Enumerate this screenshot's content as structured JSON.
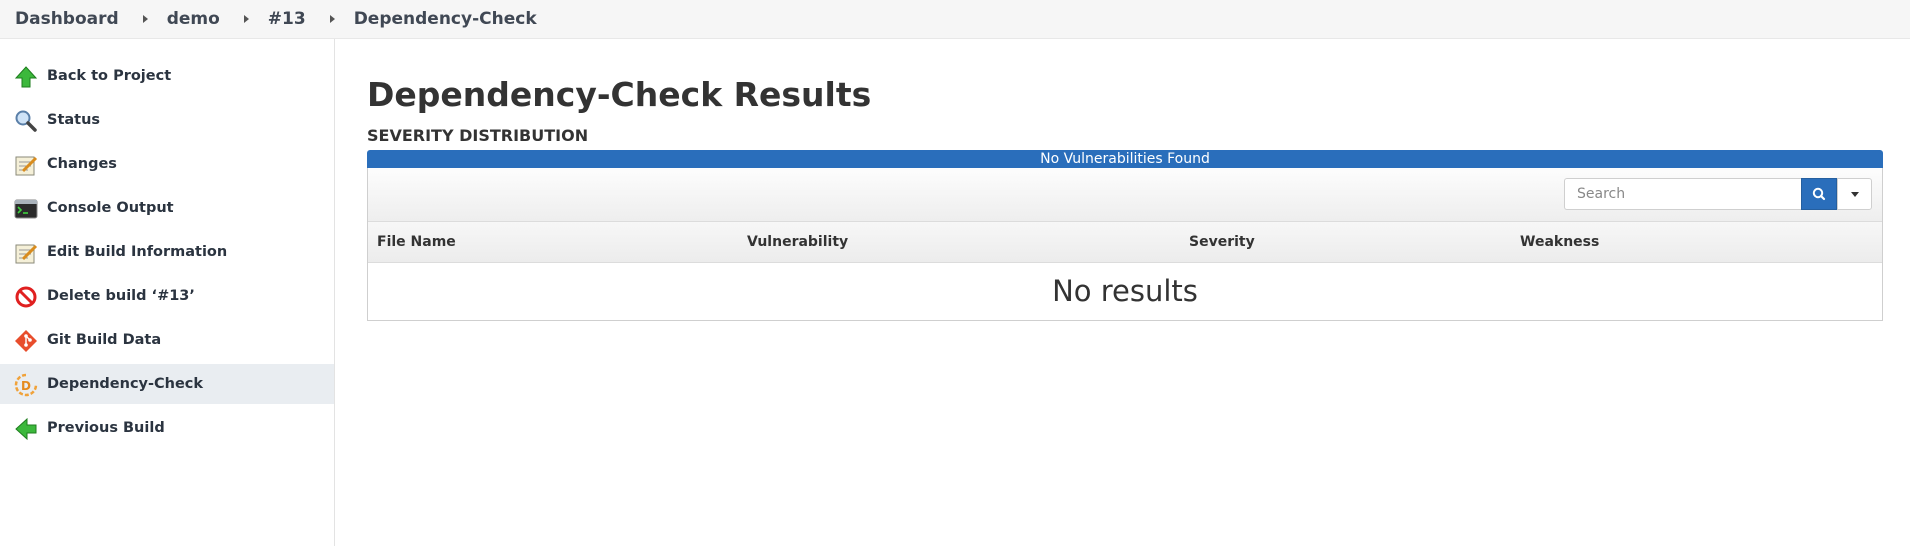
{
  "breadcrumb": {
    "items": [
      "Dashboard",
      "demo",
      "#13",
      "Dependency-Check"
    ]
  },
  "sidebar": {
    "items": [
      {
        "label": "Back to Project",
        "icon": "up-arrow-icon"
      },
      {
        "label": "Status",
        "icon": "magnifier-icon"
      },
      {
        "label": "Changes",
        "icon": "notepad-icon"
      },
      {
        "label": "Console Output",
        "icon": "terminal-icon"
      },
      {
        "label": "Edit Build Information",
        "icon": "notepad-icon"
      },
      {
        "label": "Delete build ‘#13’",
        "icon": "no-entry-icon"
      },
      {
        "label": "Git Build Data",
        "icon": "git-icon"
      },
      {
        "label": "Dependency-Check",
        "icon": "dependency-check-icon",
        "active": true
      },
      {
        "label": "Previous Build",
        "icon": "left-arrow-icon"
      }
    ]
  },
  "main": {
    "title": "Dependency-Check Results",
    "section_label": "SEVERITY DISTRIBUTION",
    "severity_bar_text": "No Vulnerabilities Found",
    "search": {
      "placeholder": "Search"
    },
    "columns": [
      "File Name",
      "Vulnerability",
      "Severity",
      "Weakness"
    ],
    "empty_text": "No results"
  },
  "colors": {
    "accent": "#2a6ebb",
    "active_sidebar": "#e9edf1"
  }
}
